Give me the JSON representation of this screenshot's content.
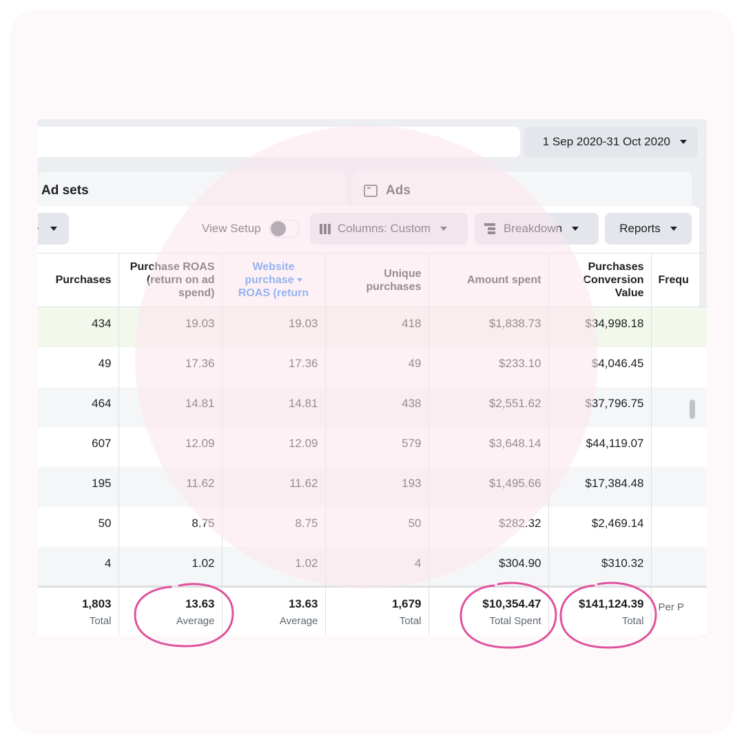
{
  "date_range": {
    "label": "1 Sep 2020-31 Oct 2020"
  },
  "tabs": {
    "ad_sets": "Ad sets",
    "ads": "Ads"
  },
  "toolbar": {
    "view_setup": "View Setup",
    "columns": "Columns: Custom",
    "breakdown": "Breakdown",
    "reports": "Reports"
  },
  "table": {
    "headers": {
      "purchases": "Purchases",
      "purchase_roas": [
        "Purchase ROAS",
        "(return on ad",
        "spend)"
      ],
      "website_roas": [
        "Website",
        "purchase",
        "ROAS (return"
      ],
      "unique_purchases": [
        "Unique",
        "purchases"
      ],
      "amount_spent": "Amount spent",
      "conversion_value": [
        "Purchases",
        "Conversion",
        "Value"
      ],
      "frequency": "Frequ"
    },
    "rows": [
      {
        "purchases": "434",
        "purchase_roas": "19.03",
        "website_roas": "19.03",
        "unique_purchases": "418",
        "amount_spent": "$1,838.73",
        "conversion_value": "$34,998.18"
      },
      {
        "purchases": "49",
        "purchase_roas": "17.36",
        "website_roas": "17.36",
        "unique_purchases": "49",
        "amount_spent": "$233.10",
        "conversion_value": "$4,046.45"
      },
      {
        "purchases": "464",
        "purchase_roas": "14.81",
        "website_roas": "14.81",
        "unique_purchases": "438",
        "amount_spent": "$2,551.62",
        "conversion_value": "$37,796.75"
      },
      {
        "purchases": "607",
        "purchase_roas": "12.09",
        "website_roas": "12.09",
        "unique_purchases": "579",
        "amount_spent": "$3,648.14",
        "conversion_value": "$44,119.07"
      },
      {
        "purchases": "195",
        "purchase_roas": "11.62",
        "website_roas": "11.62",
        "unique_purchases": "193",
        "amount_spent": "$1,495.66",
        "conversion_value": "$17,384.48"
      },
      {
        "purchases": "50",
        "purchase_roas": "8.75",
        "website_roas": "8.75",
        "unique_purchases": "50",
        "amount_spent": "$282.32",
        "conversion_value": "$2,469.14"
      },
      {
        "purchases": "4",
        "purchase_roas": "1.02",
        "website_roas": "1.02",
        "unique_purchases": "4",
        "amount_spent": "$304.90",
        "conversion_value": "$310.32"
      }
    ],
    "totals": {
      "purchases": {
        "value": "1,803",
        "label": "Total"
      },
      "purchase_roas": {
        "value": "13.63",
        "label": "Average"
      },
      "website_roas": {
        "value": "13.63",
        "label": "Average"
      },
      "unique_purchases": {
        "value": "1,679",
        "label": "Total"
      },
      "amount_spent": {
        "value": "$10,354.47",
        "label": "Total Spent"
      },
      "conversion_value": {
        "value": "$141,124.39",
        "label": "Total"
      },
      "frequency": {
        "value": "",
        "label": "Per P"
      }
    }
  },
  "annotation_color": "#e0529c"
}
